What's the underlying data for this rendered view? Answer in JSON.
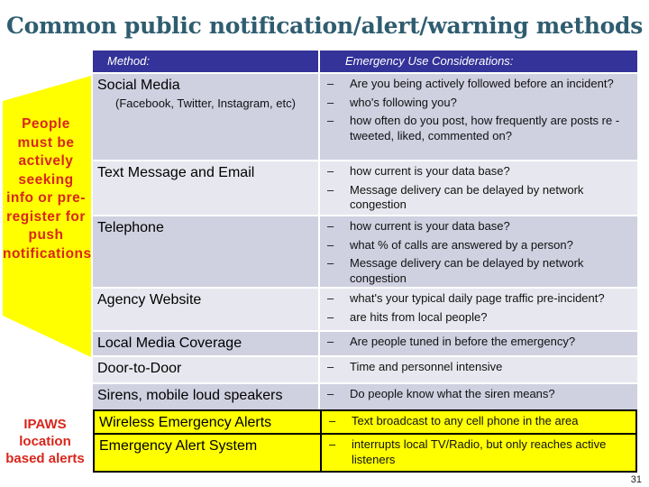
{
  "title": "Common public notification/alert/warning methods",
  "colors": {
    "header_bg": "#333399",
    "row_dark": "#cfd0e0",
    "row_light": "#e7e8ef",
    "highlight": "#ffff00",
    "side_text": "#d8261b",
    "title": "#2f5d70"
  },
  "side_labels": {
    "people": "People must be actively seeking info or pre-register for push notifications",
    "ipaws": "IPAWS location based alerts"
  },
  "table": {
    "headers": {
      "method": "Method:",
      "considerations": "Emergency Use Considerations:"
    },
    "rows": [
      {
        "method": "Social Media",
        "sub": "(Facebook, Twitter, Instagram, etc)",
        "bullets": [
          "Are you being actively followed before an incident?",
          "who's following you?",
          "how often do you post, how frequently are posts re -tweeted, liked, commented on?"
        ]
      },
      {
        "method": "Text Message and Email",
        "bullets": [
          "how current is your data base?",
          "Message delivery can be delayed by network congestion"
        ]
      },
      {
        "method": "Telephone",
        "bullets": [
          "how current is your data base?",
          "what % of calls are answered by a person?",
          "Message delivery can be delayed by network congestion"
        ]
      },
      {
        "method": "Agency Website",
        "bullets": [
          "what's your typical daily page traffic pre-incident?",
          "are hits from local people?"
        ]
      },
      {
        "method": "Local Media Coverage",
        "bullets": [
          "Are people tuned in before the emergency?"
        ]
      },
      {
        "method": "Door-to-Door",
        "bullets": [
          "Time and personnel intensive"
        ]
      },
      {
        "method": "Sirens, mobile loud speakers",
        "bullets": [
          "Do people know what the siren means?"
        ]
      },
      {
        "method": "Wireless Emergency Alerts",
        "bullets": [
          "Text broadcast to any cell phone in the area"
        ]
      },
      {
        "method": "Emergency Alert System",
        "bullets": [
          "interrupts local TV/Radio, but only reaches active listeners"
        ]
      }
    ],
    "bullet_glyph": "–"
  },
  "page_number": "31"
}
